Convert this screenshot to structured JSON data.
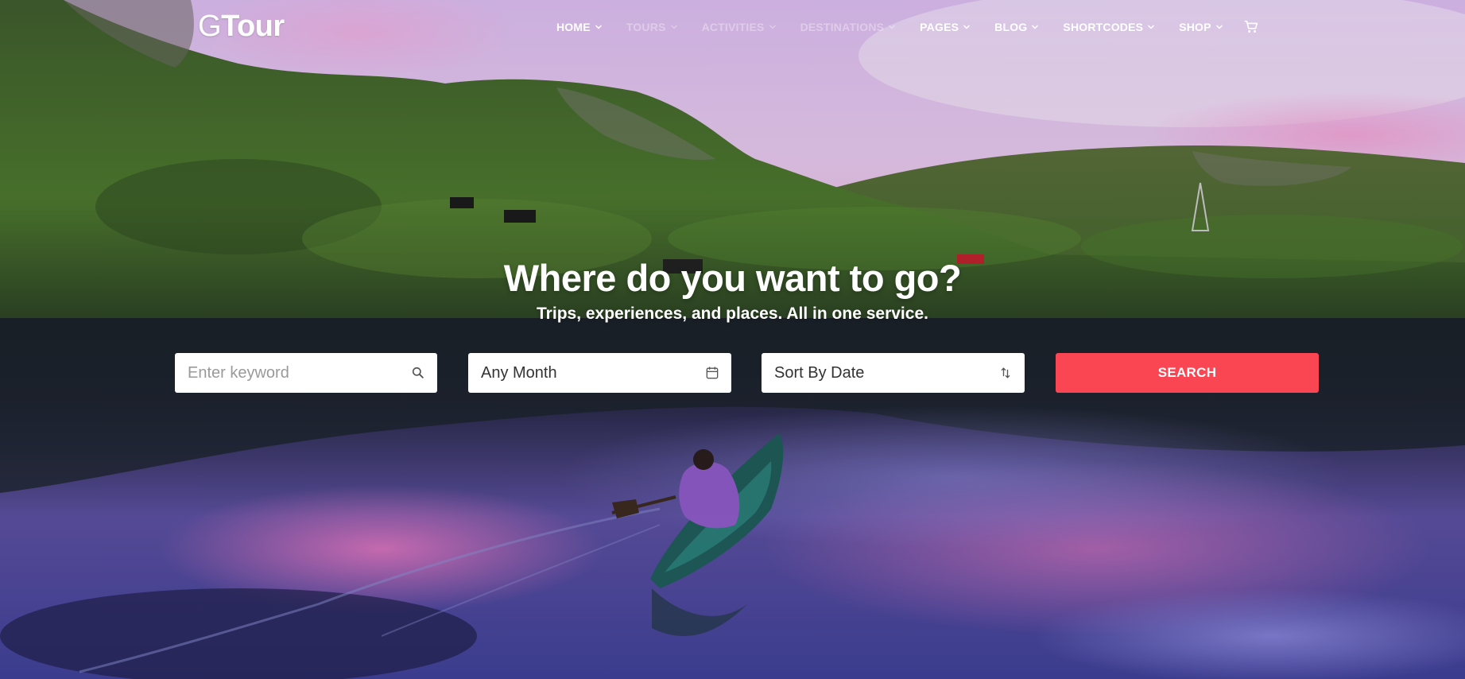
{
  "brand": {
    "logo_letter": "G",
    "logo_text": "Tour"
  },
  "nav": {
    "items": [
      {
        "label": "HOME",
        "faded": false
      },
      {
        "label": "TOURS",
        "faded": true
      },
      {
        "label": "ACTIVITIES",
        "faded": true
      },
      {
        "label": "DESTINATIONS",
        "faded": true
      },
      {
        "label": "PAGES",
        "faded": false
      },
      {
        "label": "BLOG",
        "faded": false
      },
      {
        "label": "SHORTCODES",
        "faded": false
      },
      {
        "label": "SHOP",
        "faded": false
      }
    ],
    "cart_icon": "cart-icon"
  },
  "hero": {
    "headline": "Where do you want to go?",
    "subline": "Trips, experiences, and places. All in one service."
  },
  "search": {
    "keyword_placeholder": "Enter keyword",
    "keyword_icon": "search-icon",
    "month_value": "Any Month",
    "month_icon": "calendar-icon",
    "sort_value": "Sort By Date",
    "sort_icon": "sort-icon",
    "button_label": "SEARCH"
  },
  "colors": {
    "accent": "#fa4552",
    "text_on_dark": "#ffffff"
  }
}
